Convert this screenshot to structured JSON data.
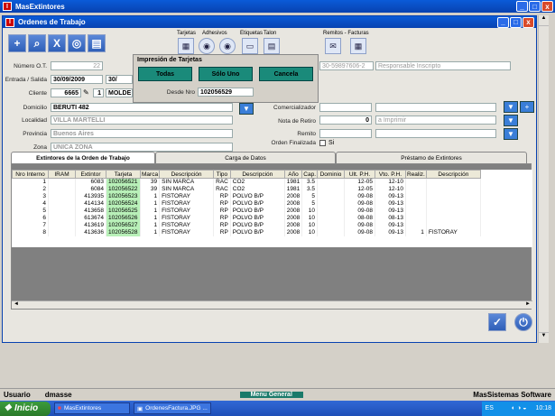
{
  "app": {
    "title": "MasExtintores",
    "window_title": "Ordenes de Trabajo"
  },
  "window_buttons": {
    "minimize": "_",
    "maximize": "□",
    "close": "x"
  },
  "toolbar": {
    "groups": [
      "Tarjetas",
      "Adhesivos",
      "Etiquetas",
      "Talon",
      "Remitos - Facturas"
    ]
  },
  "form": {
    "numero_ot_label": "Número O.T.",
    "numero_ot": "22",
    "entrada_label": "Entrada / Salida",
    "entrada": "30/09/2009",
    "salida": "30/",
    "cliente_label": "Cliente",
    "cliente_code": "6665",
    "cliente_sub": "1",
    "cliente_name": "MOLDE",
    "domicilio_label": "Domicilio",
    "domicilio": "BERUTI 482",
    "localidad_label": "Localidad",
    "localidad": "VILLA MARTELLI",
    "provincia_label": "Provincia",
    "provincia": "Buenos Aires",
    "zona_label": "Zona",
    "zona": "UNICA ZONA",
    "cuit": "30-59897606-2",
    "iva": "Responsable Inscripto",
    "comercializador_label": "Comercializador",
    "nota_label": "Nota de Retiro",
    "nota": "0",
    "nota_status": "a Imprimir",
    "remito_label": "Remito",
    "orden_label": "Orden Finalizada",
    "orden_value": "Si"
  },
  "popup": {
    "title": "Impresión de Tarjetas",
    "todas": "Todas",
    "solo_uno": "Sólo Uno",
    "cancela": "Cancela",
    "desde_label": "Desde Nro",
    "desde": "102056529"
  },
  "tabs": [
    "Extintores de la Orden de Trabajo",
    "Carga de Datos",
    "Préstamo de Extintores"
  ],
  "table": {
    "headers": [
      "Nro Interno",
      "IRAM",
      "Extintor",
      "Tarjeta",
      "Marca",
      "Descripción",
      "Tipo",
      "Descripción",
      "Año",
      "Cap.",
      "Dominio",
      "Ult. P.H.",
      "Vto. P.H.",
      "Realiz.",
      "Descripción"
    ],
    "rows": [
      [
        "1",
        "",
        "6083",
        "102056521",
        "39",
        "SIN MARCA",
        "RAC",
        "CO2",
        "1981",
        "3.5",
        "",
        "12-05",
        "12-10",
        "",
        ""
      ],
      [
        "2",
        "",
        "6084",
        "102056522",
        "39",
        "SIN MARCA",
        "RAC",
        "CO2",
        "1981",
        "3.5",
        "",
        "12-05",
        "12-10",
        "",
        ""
      ],
      [
        "3",
        "",
        "413935",
        "102056523",
        "1",
        "FISTORAY",
        "RP",
        "POLVO B/P",
        "2008",
        "5",
        "",
        "09-08",
        "09-13",
        "",
        ""
      ],
      [
        "4",
        "",
        "414134",
        "102056524",
        "1",
        "FISTORAY",
        "RP",
        "POLVO B/P",
        "2008",
        "5",
        "",
        "09-08",
        "09-13",
        "",
        ""
      ],
      [
        "5",
        "",
        "413658",
        "102056525",
        "1",
        "FISTORAY",
        "RP",
        "POLVO B/P",
        "2008",
        "10",
        "",
        "09-08",
        "09-13",
        "",
        ""
      ],
      [
        "6",
        "",
        "613674",
        "102056526",
        "1",
        "FISTORAY",
        "RP",
        "POLVO B/P",
        "2008",
        "10",
        "",
        "08-08",
        "08-13",
        "",
        ""
      ],
      [
        "7",
        "",
        "413619",
        "102056527",
        "1",
        "FISTORAY",
        "RP",
        "POLVO B/P",
        "2008",
        "10",
        "",
        "09-08",
        "09-13",
        "",
        ""
      ],
      [
        "8",
        "",
        "413636",
        "102056528",
        "1",
        "FISTORAY",
        "RP",
        "POLVO B/P",
        "2008",
        "10",
        "",
        "09-08",
        "09-13",
        "1",
        "FISTORAY"
      ]
    ]
  },
  "status": {
    "user_label": "Usuario",
    "user": "dmasse",
    "menu": "Menu General",
    "brand": "MasSistemas Software"
  },
  "taskbar": {
    "start": "Inicio",
    "task1": "MasExtintores",
    "task2": "OrdenesFactura.JPG ...",
    "lang": "ES",
    "time": "10:18"
  }
}
